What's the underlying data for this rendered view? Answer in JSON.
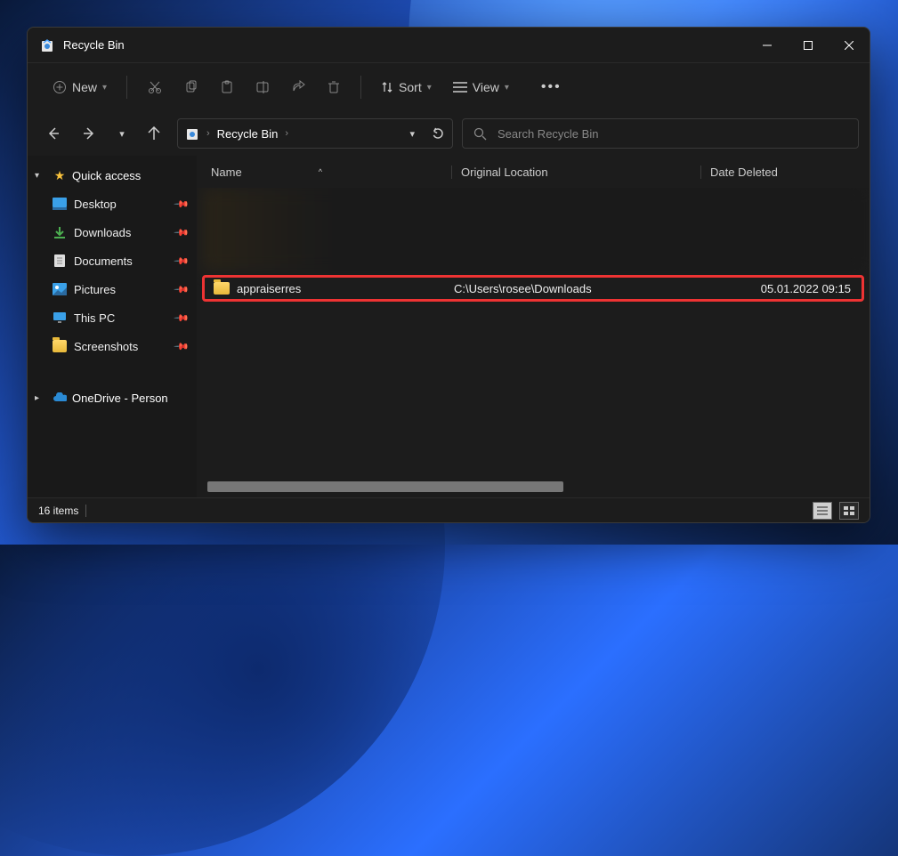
{
  "titlebar": {
    "title": "Recycle Bin"
  },
  "toolbar": {
    "new_label": "New",
    "sort_label": "Sort",
    "view_label": "View"
  },
  "address": {
    "crumb": "Recycle Bin"
  },
  "search": {
    "placeholder": "Search Recycle Bin"
  },
  "sidebar": {
    "quick": "Quick access",
    "items": [
      {
        "label": "Desktop"
      },
      {
        "label": "Downloads"
      },
      {
        "label": "Documents"
      },
      {
        "label": "Pictures"
      },
      {
        "label": "This PC"
      },
      {
        "label": "Screenshots"
      }
    ],
    "onedrive": "OneDrive - Person"
  },
  "columns": {
    "name": "Name",
    "loc": "Original Location",
    "date": "Date Deleted"
  },
  "rows": [
    {
      "name": "appraiserres",
      "loc": "C:\\Users\\rosee\\Downloads",
      "date": "05.01.2022 09:15"
    }
  ],
  "status": {
    "count": "16 items"
  }
}
